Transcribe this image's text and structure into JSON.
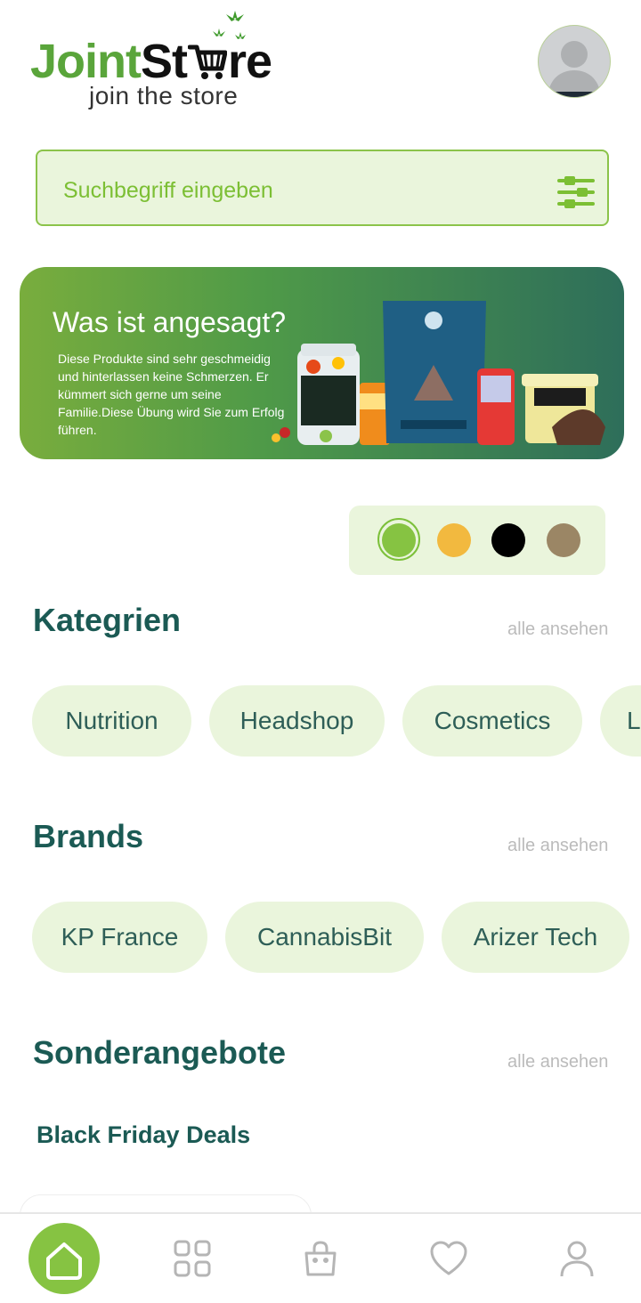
{
  "app": {
    "logo_text_primary": "Joint",
    "logo_text_secondary": "St",
    "logo_text_suffix": "re",
    "logo_tagline": "join the store"
  },
  "search": {
    "placeholder": "Suchbegriff eingeben",
    "filter_icon": "sliders-icon"
  },
  "banner": {
    "title": "Was ist angesagt?",
    "text": "Diese Produkte sind sehr geschmeidig und hinterlassen keine Schmerzen. Er kümmert sich gerne um seine Familie.Diese Übung wird Sie zum Erfolg führen."
  },
  "color_options": {
    "selected": "#86c342",
    "colors": [
      "#86c342",
      "#f2b93f",
      "#000000",
      "#9b8665"
    ]
  },
  "categories": {
    "title": "Kategrien",
    "see_all": "alle ansehen",
    "items": [
      "Nutrition",
      "Headshop",
      "Cosmetics",
      "L"
    ]
  },
  "brands": {
    "title": "Brands",
    "see_all": "alle ansehen",
    "items": [
      "KP France",
      "CannabisBit",
      "Arizer Tech"
    ]
  },
  "offers": {
    "title": "Sonderangebote",
    "see_all": "alle ansehen",
    "subheading": "Black Friday Deals"
  },
  "navbar": {
    "items": [
      "home-icon",
      "grid-icon",
      "bag-icon",
      "heart-icon",
      "user-icon"
    ],
    "active": "home-icon"
  },
  "theme": {
    "accent": "#86c342",
    "heading": "#1b5a54",
    "chip_bg": "#eaf5dc"
  }
}
